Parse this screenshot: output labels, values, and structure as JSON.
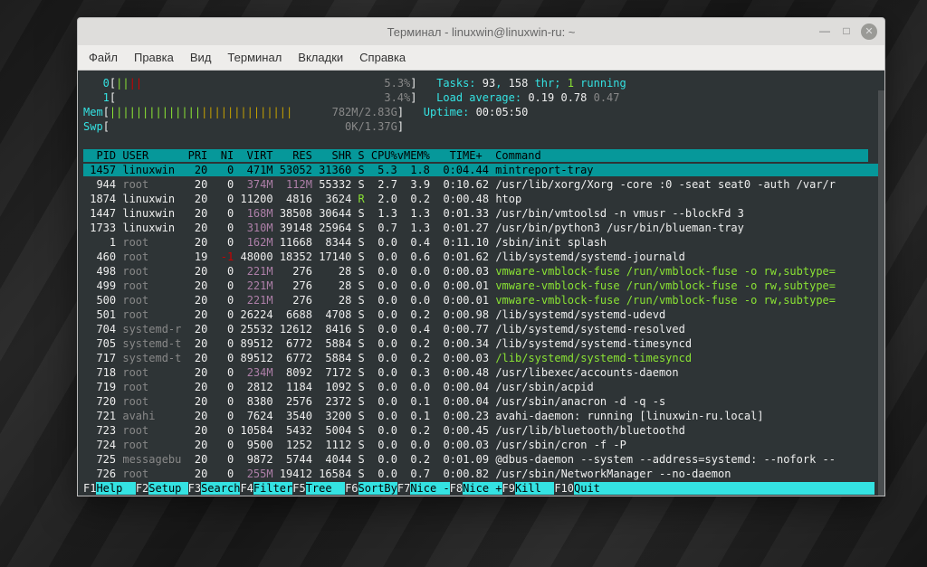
{
  "window": {
    "title": "Терминал - linuxwin@linuxwin-ru: ~"
  },
  "menu": [
    "Файл",
    "Правка",
    "Вид",
    "Терминал",
    "Вкладки",
    "Справка"
  ],
  "meters": {
    "cpu0": {
      "label": "0",
      "bar": "[|||                                      ",
      "pct": "5.3%",
      "close": "]"
    },
    "cpu1": {
      "label": "1",
      "bar": "[                                         ",
      "pct": "3.4%",
      "close": "]"
    },
    "mem": {
      "label": "Mem",
      "bar": "[|||||||||||||||||||||||||||        ",
      "val": "782M/2.83G",
      "close": "]"
    },
    "swp": {
      "label": "Swp",
      "bar": "[                                    ",
      "val": "0K/1.37G",
      "close": "]"
    }
  },
  "summary": {
    "tasks_lbl": "Tasks: ",
    "tasks_a": "93",
    "tasks_sep": ", ",
    "tasks_b": "158",
    "thr": " thr; ",
    "running": "1",
    "running_lbl": " running",
    "la_lbl": "Load average: ",
    "la1": "0.19",
    "la2": "0.78",
    "la3": "0.47",
    "up_lbl": "Uptime: ",
    "up_val": "00:05:50"
  },
  "header": "  PID USER      PRI  NI  VIRT   RES   SHR S CPU%vMEM%   TIME+  Command                                     ",
  "rows": [
    {
      "sel": true,
      "pid": "1457",
      "user": "linuxwin",
      "pri": "20",
      "ni": "0",
      "virt": "471M",
      "res": "53052",
      "shr": "31360",
      "s": "S",
      "cpu": "5.3",
      "mem": "1.8",
      "time": "0:04.44",
      "cmd": "mintreport-tray"
    },
    {
      "pid": "944",
      "user": "root",
      "grey": true,
      "pri": "20",
      "ni": "0",
      "virt": "374M",
      "virtC": "mag",
      "res": "112M",
      "resC": "mag",
      "shr": "55332",
      "s": "S",
      "cpu": "2.7",
      "mem": "3.9",
      "time": "0:10.62",
      "cmd": "/usr/lib/xorg/Xorg -core :0 -seat seat0 -auth /var/r"
    },
    {
      "pid": "1874",
      "user": "linuxwin",
      "pri": "20",
      "ni": "0",
      "virt": "11200",
      "res": "4816",
      "shr": "3624",
      "s": "R",
      "sC": "greenb",
      "cpu": "2.0",
      "mem": "0.2",
      "time": "0:00.48",
      "cmd": "htop"
    },
    {
      "pid": "1447",
      "user": "linuxwin",
      "pri": "20",
      "ni": "0",
      "virt": "168M",
      "virtC": "mag",
      "res": "38508",
      "shr": "30644",
      "s": "S",
      "cpu": "1.3",
      "mem": "1.3",
      "time": "0:01.33",
      "cmd": "/usr/bin/vmtoolsd -n vmusr --blockFd 3"
    },
    {
      "pid": "1733",
      "user": "linuxwin",
      "pri": "20",
      "ni": "0",
      "virt": "310M",
      "virtC": "mag",
      "res": "39148",
      "shr": "25964",
      "s": "S",
      "cpu": "0.7",
      "mem": "1.3",
      "time": "0:01.27",
      "cmd": "/usr/bin/python3 /usr/bin/blueman-tray"
    },
    {
      "pid": "1",
      "user": "root",
      "grey": true,
      "pri": "20",
      "ni": "0",
      "virt": "162M",
      "virtC": "mag",
      "res": "11668",
      "shr": "8344",
      "s": "S",
      "cpu": "0.0",
      "mem": "0.4",
      "time": "0:11.10",
      "cmd": "/sbin/init splash"
    },
    {
      "pid": "460",
      "user": "root",
      "grey": true,
      "pri": "19",
      "ni": "-1",
      "niC": "red",
      "virt": "48000",
      "res": "18352",
      "shr": "17140",
      "s": "S",
      "cpu": "0.0",
      "mem": "0.6",
      "time": "0:01.62",
      "cmd": "/lib/systemd/systemd-journald"
    },
    {
      "pid": "498",
      "user": "root",
      "grey": true,
      "pri": "20",
      "ni": "0",
      "virt": "221M",
      "virtC": "mag",
      "res": "276",
      "shr": "28",
      "s": "S",
      "cpu": "0.0",
      "mem": "0.0",
      "time": "0:00.03",
      "cmd": "vmware-vmblock-fuse /run/vmblock-fuse -o rw,subtype=",
      "cmdC": "greenb"
    },
    {
      "pid": "499",
      "user": "root",
      "grey": true,
      "pri": "20",
      "ni": "0",
      "virt": "221M",
      "virtC": "mag",
      "res": "276",
      "shr": "28",
      "s": "S",
      "cpu": "0.0",
      "mem": "0.0",
      "time": "0:00.01",
      "cmd": "vmware-vmblock-fuse /run/vmblock-fuse -o rw,subtype=",
      "cmdC": "greenb"
    },
    {
      "pid": "500",
      "user": "root",
      "grey": true,
      "pri": "20",
      "ni": "0",
      "virt": "221M",
      "virtC": "mag",
      "res": "276",
      "shr": "28",
      "s": "S",
      "cpu": "0.0",
      "mem": "0.0",
      "time": "0:00.01",
      "cmd": "vmware-vmblock-fuse /run/vmblock-fuse -o rw,subtype=",
      "cmdC": "greenb"
    },
    {
      "pid": "501",
      "user": "root",
      "grey": true,
      "pri": "20",
      "ni": "0",
      "virt": "26224",
      "res": "6688",
      "shr": "4708",
      "s": "S",
      "cpu": "0.0",
      "mem": "0.2",
      "time": "0:00.98",
      "cmd": "/lib/systemd/systemd-udevd"
    },
    {
      "pid": "704",
      "user": "systemd-r",
      "grey": true,
      "pri": "20",
      "ni": "0",
      "virt": "25532",
      "res": "12612",
      "shr": "8416",
      "s": "S",
      "cpu": "0.0",
      "mem": "0.4",
      "time": "0:00.77",
      "cmd": "/lib/systemd/systemd-resolved"
    },
    {
      "pid": "705",
      "user": "systemd-t",
      "grey": true,
      "pri": "20",
      "ni": "0",
      "virt": "89512",
      "res": "6772",
      "shr": "5884",
      "s": "S",
      "cpu": "0.0",
      "mem": "0.2",
      "time": "0:00.34",
      "cmd": "/lib/systemd/systemd-timesyncd"
    },
    {
      "pid": "717",
      "user": "systemd-t",
      "grey": true,
      "pri": "20",
      "ni": "0",
      "virt": "89512",
      "res": "6772",
      "shr": "5884",
      "s": "S",
      "cpu": "0.0",
      "mem": "0.2",
      "time": "0:00.03",
      "cmd": "/lib/systemd/systemd-timesyncd",
      "cmdC": "greenb"
    },
    {
      "pid": "718",
      "user": "root",
      "grey": true,
      "pri": "20",
      "ni": "0",
      "virt": "234M",
      "virtC": "mag",
      "res": "8092",
      "shr": "7172",
      "s": "S",
      "cpu": "0.0",
      "mem": "0.3",
      "time": "0:00.48",
      "cmd": "/usr/libexec/accounts-daemon"
    },
    {
      "pid": "719",
      "user": "root",
      "grey": true,
      "pri": "20",
      "ni": "0",
      "virt": "2812",
      "res": "1184",
      "shr": "1092",
      "s": "S",
      "cpu": "0.0",
      "mem": "0.0",
      "time": "0:00.04",
      "cmd": "/usr/sbin/acpid"
    },
    {
      "pid": "720",
      "user": "root",
      "grey": true,
      "pri": "20",
      "ni": "0",
      "virt": "8380",
      "res": "2576",
      "shr": "2372",
      "s": "S",
      "cpu": "0.0",
      "mem": "0.1",
      "time": "0:00.04",
      "cmd": "/usr/sbin/anacron -d -q -s"
    },
    {
      "pid": "721",
      "user": "avahi",
      "grey": true,
      "pri": "20",
      "ni": "0",
      "virt": "7624",
      "res": "3540",
      "shr": "3200",
      "s": "S",
      "cpu": "0.0",
      "mem": "0.1",
      "time": "0:00.23",
      "cmd": "avahi-daemon: running [linuxwin-ru.local]"
    },
    {
      "pid": "723",
      "user": "root",
      "grey": true,
      "pri": "20",
      "ni": "0",
      "virt": "10584",
      "res": "5432",
      "shr": "5004",
      "s": "S",
      "cpu": "0.0",
      "mem": "0.2",
      "time": "0:00.45",
      "cmd": "/usr/lib/bluetooth/bluetoothd"
    },
    {
      "pid": "724",
      "user": "root",
      "grey": true,
      "pri": "20",
      "ni": "0",
      "virt": "9500",
      "res": "1252",
      "shr": "1112",
      "s": "S",
      "cpu": "0.0",
      "mem": "0.0",
      "time": "0:00.03",
      "cmd": "/usr/sbin/cron -f -P"
    },
    {
      "pid": "725",
      "user": "messagebu",
      "grey": true,
      "pri": "20",
      "ni": "0",
      "virt": "9872",
      "res": "5744",
      "shr": "4044",
      "s": "S",
      "cpu": "0.0",
      "mem": "0.2",
      "time": "0:01.09",
      "cmd": "@dbus-daemon --system --address=systemd: --nofork --"
    },
    {
      "pid": "726",
      "user": "root",
      "grey": true,
      "pri": "20",
      "ni": "0",
      "virt": "255M",
      "virtC": "mag",
      "res": "19412",
      "shr": "16584",
      "s": "S",
      "cpu": "0.0",
      "mem": "0.7",
      "time": "0:00.82",
      "cmd": "/usr/sbin/NetworkManager --no-daemon"
    }
  ],
  "fkeys": [
    {
      "k": "F1",
      "l": "Help  "
    },
    {
      "k": "F2",
      "l": "Setup "
    },
    {
      "k": "F3",
      "l": "Search"
    },
    {
      "k": "F4",
      "l": "Filter"
    },
    {
      "k": "F5",
      "l": "Tree  "
    },
    {
      "k": "F6",
      "l": "SortBy"
    },
    {
      "k": "F7",
      "l": "Nice -"
    },
    {
      "k": "F8",
      "l": "Nice +"
    },
    {
      "k": "F9",
      "l": "Kill  "
    },
    {
      "k": "F10",
      "l": "Quit  "
    }
  ]
}
